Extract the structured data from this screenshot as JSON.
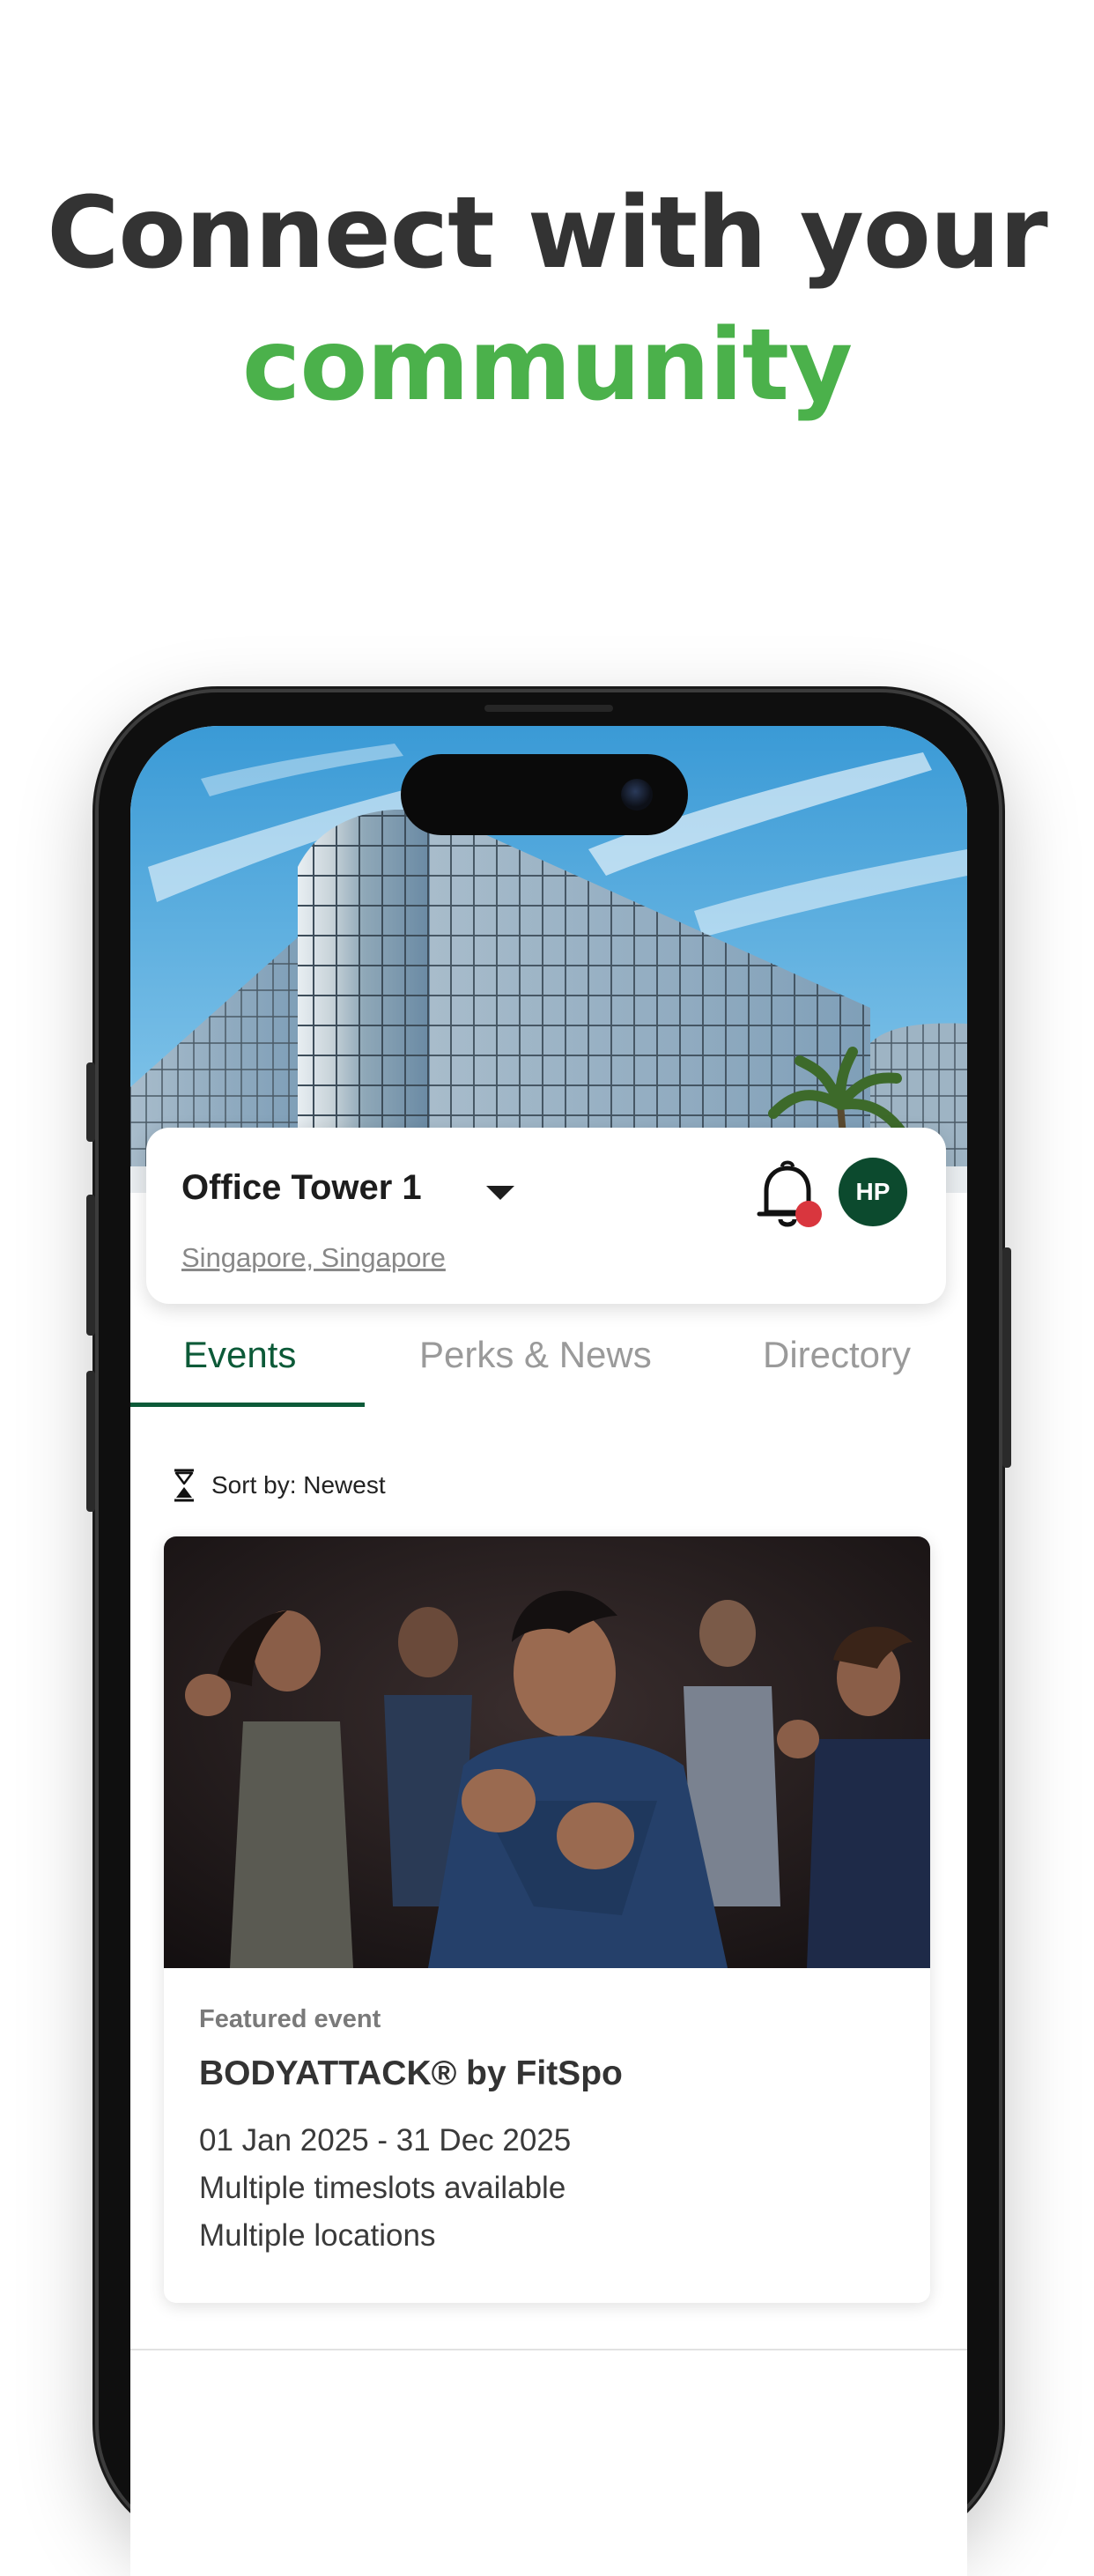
{
  "headline": {
    "line1": "Connect with your",
    "line2": "community",
    "accent_color": "#4bb14b"
  },
  "location": {
    "name": "Office Tower 1",
    "subtitle": "Singapore, Singapore",
    "dropdown_icon": "caret-down-icon"
  },
  "header": {
    "notification_icon": "bell-icon",
    "notification_badge_color": "#d9363e",
    "avatar_initials": "HP",
    "avatar_color": "#0c4a2e"
  },
  "tabs": [
    {
      "label": "Events",
      "active": true
    },
    {
      "label": "Perks & News",
      "active": false
    },
    {
      "label": "Directory",
      "active": false
    }
  ],
  "sort": {
    "label": "Sort by: Newest",
    "icon": "hourglass-sort-icon"
  },
  "event": {
    "badge": "Featured event",
    "title": "BODYATTACK® by FitSpo",
    "dates": "01 Jan 2025 - 31 Dec 2025",
    "timeslots": "Multiple timeslots available",
    "locations": "Multiple locations"
  },
  "colors": {
    "brand_dark_green": "#0c5a38",
    "headline_dark": "#333333"
  }
}
